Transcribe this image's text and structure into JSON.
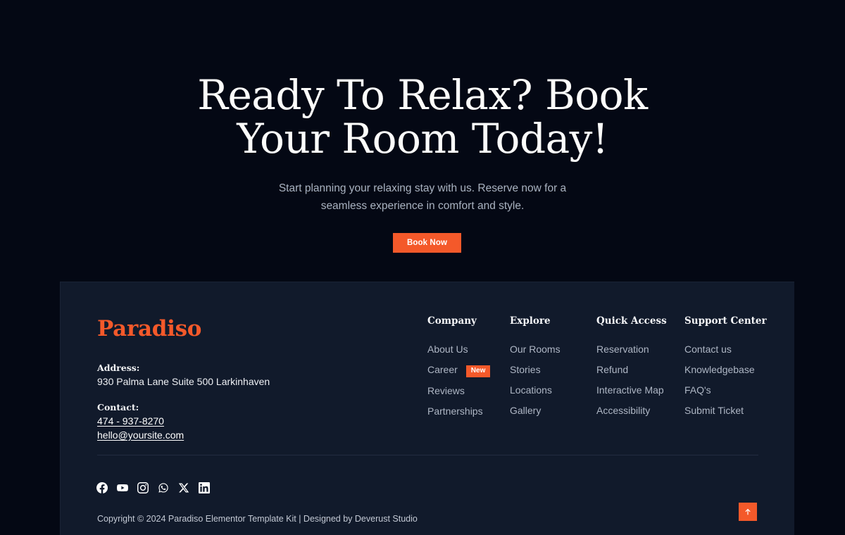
{
  "theme": {
    "page_bg": "#040814",
    "footer_bg": "#111a2b",
    "accent": "#f4592a",
    "heading_color": "#fdfdfb",
    "muted_text": "#aab3c1",
    "link_color": "#aeb6c4"
  },
  "cta": {
    "heading_line1": "Ready To Relax? Book",
    "heading_line2": "Your Room Today!",
    "sub_line1": "Start planning your relaxing stay with us. Reserve now for a",
    "sub_line2": "seamless experience in comfort and style.",
    "button_label": "Book Now"
  },
  "footer": {
    "brand": "Paradiso",
    "address_label": "Address:",
    "address_value": "930 Palma Lane Suite 500 Larkinhaven",
    "contact_label": "Contact:",
    "phone": "474 - 937-8270",
    "email": "hello@yoursite.com",
    "columns": [
      {
        "title": "Company",
        "links": [
          {
            "label": "About Us",
            "badge": ""
          },
          {
            "label": "Career",
            "badge": "New"
          },
          {
            "label": "Reviews",
            "badge": ""
          },
          {
            "label": "Partnerships",
            "badge": ""
          }
        ]
      },
      {
        "title": "Explore",
        "links": [
          {
            "label": "Our Rooms",
            "badge": ""
          },
          {
            "label": "Stories",
            "badge": ""
          },
          {
            "label": "Locations",
            "badge": ""
          },
          {
            "label": "Gallery",
            "badge": ""
          }
        ]
      },
      {
        "title": "Quick Access",
        "links": [
          {
            "label": "Reservation",
            "badge": ""
          },
          {
            "label": "Refund",
            "badge": ""
          },
          {
            "label": "Interactive Map",
            "badge": ""
          },
          {
            "label": "Accessibility",
            "badge": ""
          }
        ]
      },
      {
        "title": "Support Center",
        "links": [
          {
            "label": "Contact us",
            "badge": ""
          },
          {
            "label": "Knowledgebase",
            "badge": ""
          },
          {
            "label": "FAQ's",
            "badge": ""
          },
          {
            "label": "Submit Ticket",
            "badge": ""
          }
        ]
      }
    ],
    "socials": [
      {
        "name": "facebook-icon"
      },
      {
        "name": "youtube-icon"
      },
      {
        "name": "instagram-icon"
      },
      {
        "name": "whatsapp-icon"
      },
      {
        "name": "x-twitter-icon"
      },
      {
        "name": "linkedin-icon"
      }
    ],
    "copyright": "Copyright © 2024 Paradiso Elementor Template Kit | Designed by Deverust Studio",
    "scroll_top_icon": "arrow-up-icon"
  }
}
